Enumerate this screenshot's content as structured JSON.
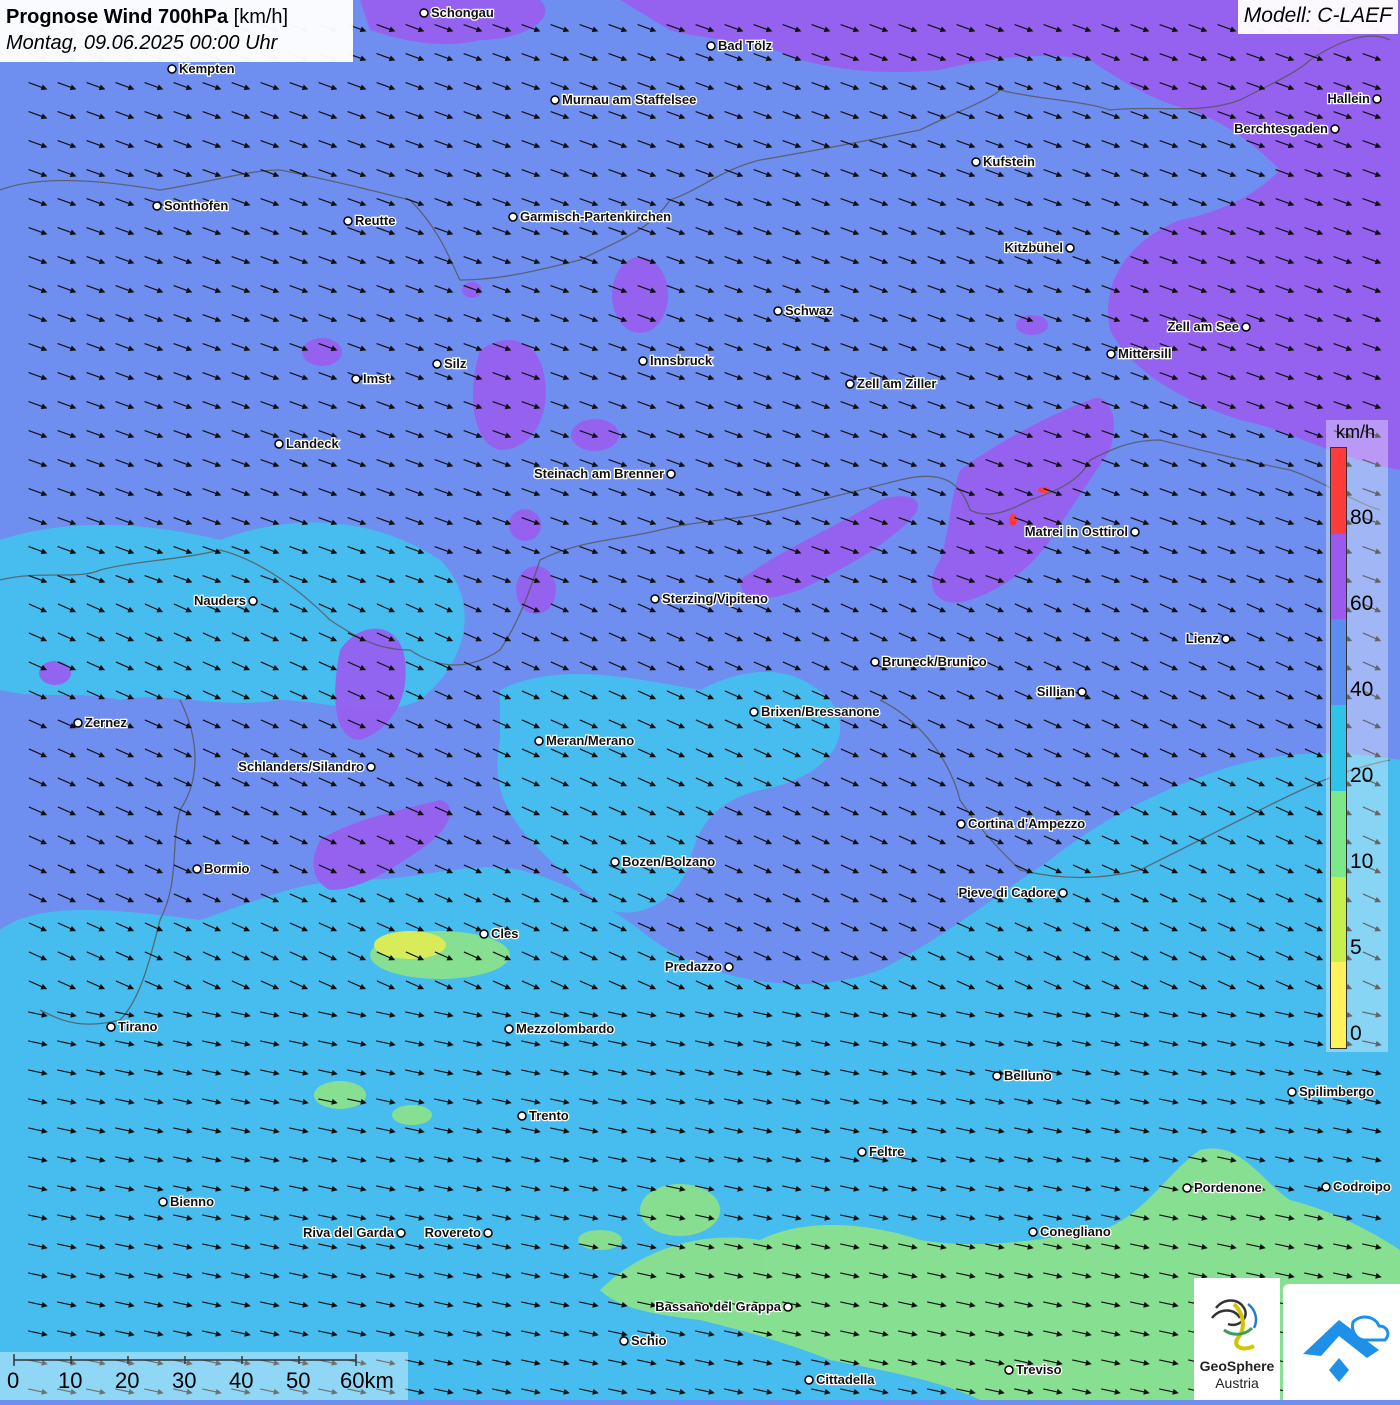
{
  "header": {
    "title_bold": "Prognose Wind 700hPa",
    "title_unit": "[km/h]",
    "datetime": "Montag, 09.06.2025 00:00 Uhr",
    "model": "Modell: C-LAEF"
  },
  "legend": {
    "unit": "km/h",
    "ticks": [
      "80",
      "60",
      "40",
      "20",
      "10",
      "5",
      "0"
    ],
    "colors": [
      "#ff3b3b",
      "#9b59f0",
      "#5b8cf0",
      "#2ec4e8",
      "#7be88a",
      "#c8f04a",
      "#fff25a"
    ]
  },
  "scalebar": {
    "labels": [
      "0",
      "10",
      "20",
      "30",
      "40",
      "50",
      "60km"
    ]
  },
  "logo": {
    "name_line1": "GeoSphere",
    "name_line2": "Austria"
  },
  "places": [
    {
      "name": "Schongau"
    },
    {
      "name": "Bad Tölz"
    },
    {
      "name": "Kempten"
    },
    {
      "name": "Murnau am Staffelsee"
    },
    {
      "name": "Hallein"
    },
    {
      "name": "Berchtesgaden"
    },
    {
      "name": "Kufstein"
    },
    {
      "name": "Sonthofen"
    },
    {
      "name": "Reutte"
    },
    {
      "name": "Garmisch-Partenkirchen"
    },
    {
      "name": "Kitzbühel"
    },
    {
      "name": "Schwaz"
    },
    {
      "name": "Zell am See"
    },
    {
      "name": "Silz"
    },
    {
      "name": "Innsbruck"
    },
    {
      "name": "Mittersill"
    },
    {
      "name": "Imst"
    },
    {
      "name": "Zell am Ziller"
    },
    {
      "name": "Landeck"
    },
    {
      "name": "Steinach am Brenner"
    },
    {
      "name": "Matrei in Osttirol"
    },
    {
      "name": "Nauders"
    },
    {
      "name": "Sterzing/Vipiteno"
    },
    {
      "name": "Lienz"
    },
    {
      "name": "Bruneck/Brunico"
    },
    {
      "name": "Sillian"
    },
    {
      "name": "Zernez"
    },
    {
      "name": "Brixen/Bressanone"
    },
    {
      "name": "Meran/Merano"
    },
    {
      "name": "Schlanders/Silandro"
    },
    {
      "name": "Cortina d'Ampezzo"
    },
    {
      "name": "Bozen/Bolzano"
    },
    {
      "name": "Bormio"
    },
    {
      "name": "Pieve di Cadore"
    },
    {
      "name": "Cles"
    },
    {
      "name": "Predazzo"
    },
    {
      "name": "Tirano"
    },
    {
      "name": "Mezzolombardo"
    },
    {
      "name": "Belluno"
    },
    {
      "name": "Spilimbergo"
    },
    {
      "name": "Trento"
    },
    {
      "name": "Feltre"
    },
    {
      "name": "Pordenone"
    },
    {
      "name": "Codroipo"
    },
    {
      "name": "Bienno"
    },
    {
      "name": "Riva del Garda"
    },
    {
      "name": "Rovereto"
    },
    {
      "name": "Conegliano"
    },
    {
      "name": "Bassano del Grappa"
    },
    {
      "name": "Schio"
    },
    {
      "name": "Treviso"
    },
    {
      "name": "Cittadella"
    }
  ]
}
